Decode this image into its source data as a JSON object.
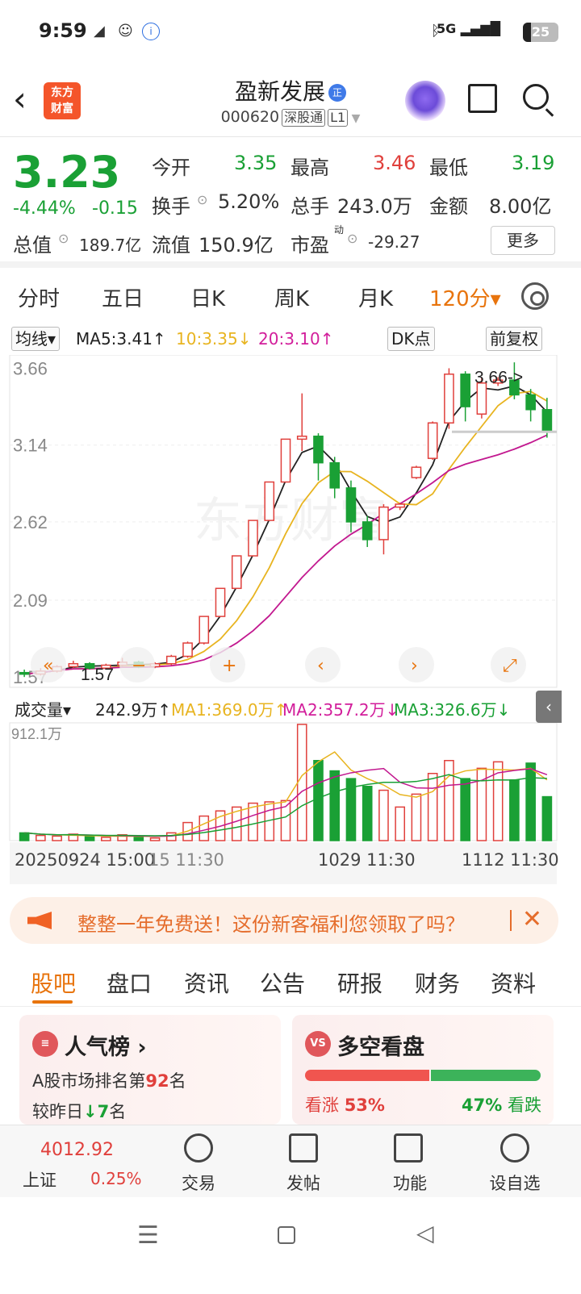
{
  "status": {
    "time": "9:59",
    "network": "5G",
    "battery": "25"
  },
  "header": {
    "back": "‹",
    "logo": "东方\n财富",
    "title": "盈新发展",
    "title_badge": "正",
    "code": "000620",
    "tag1": "深股通",
    "tag2": "L1"
  },
  "quote": {
    "price": "3.23",
    "pct": "-4.44%",
    "chg": "-0.15",
    "open_label": "今开",
    "open": "3.35",
    "high_label": "最高",
    "high": "3.46",
    "low_label": "最低",
    "low": "3.19",
    "turnover_label": "换手",
    "turnover": "5.20%",
    "vol_label": "总手",
    "vol": "243.0万",
    "amt_label": "金额",
    "amt": "8.00亿",
    "cap_label": "总值",
    "cap": "189.7亿",
    "float_label": "流值",
    "float": "150.9亿",
    "pe_label": "市盈",
    "pe_sup": "动",
    "pe": "-29.27",
    "more": "更多"
  },
  "tabs": [
    "分时",
    "五日",
    "日K",
    "周K",
    "月K",
    "120分▾"
  ],
  "ma": {
    "sel": "均线▾",
    "ma5": "MA5:3.41↑",
    "ma10": "10:3.35↓",
    "ma20": "20:3.10↑",
    "dk": "DK点",
    "fq": "前复权"
  },
  "chart_data": {
    "type": "candlestick",
    "yticks": [
      "3.66",
      "3.14",
      "2.62",
      "2.09",
      "1.57"
    ],
    "high_label": "3.66->",
    "low_label": "1.57",
    "vol_max": "912.1万",
    "volume_bar": {
      "sel": "成交量▾",
      "vol": "242.9万↑",
      "ma1": "MA1:369.0万↑",
      "ma2": "MA2:357.2万↓",
      "ma3": "MA3:326.6万↓"
    },
    "x_labels": [
      "20250924 15:00",
      "15 11:30",
      "1029 11:30",
      "1112 11:30"
    ],
    "watermark": "东方财富",
    "candles": [
      {
        "o": 1.6,
        "c": 1.59,
        "h": 1.62,
        "l": 1.57
      },
      {
        "o": 1.59,
        "c": 1.61,
        "h": 1.63,
        "l": 1.58
      },
      {
        "o": 1.61,
        "c": 1.64,
        "h": 1.65,
        "l": 1.6
      },
      {
        "o": 1.64,
        "c": 1.66,
        "h": 1.68,
        "l": 1.63
      },
      {
        "o": 1.66,
        "c": 1.63,
        "h": 1.67,
        "l": 1.62
      },
      {
        "o": 1.63,
        "c": 1.65,
        "h": 1.66,
        "l": 1.62
      },
      {
        "o": 1.65,
        "c": 1.67,
        "h": 1.7,
        "l": 1.64
      },
      {
        "o": 1.67,
        "c": 1.64,
        "h": 1.68,
        "l": 1.63
      },
      {
        "o": 1.64,
        "c": 1.66,
        "h": 1.67,
        "l": 1.63
      },
      {
        "o": 1.66,
        "c": 1.71,
        "h": 1.72,
        "l": 1.65
      },
      {
        "o": 1.71,
        "c": 1.8,
        "h": 1.81,
        "l": 1.7
      },
      {
        "o": 1.8,
        "c": 1.98,
        "h": 1.98,
        "l": 1.79
      },
      {
        "o": 1.98,
        "c": 2.17,
        "h": 2.17,
        "l": 1.98
      },
      {
        "o": 2.17,
        "c": 2.39,
        "h": 2.39,
        "l": 2.17
      },
      {
        "o": 2.39,
        "c": 2.63,
        "h": 2.63,
        "l": 2.39
      },
      {
        "o": 2.63,
        "c": 2.89,
        "h": 2.89,
        "l": 2.63
      },
      {
        "o": 2.89,
        "c": 3.18,
        "h": 3.18,
        "l": 3.18
      },
      {
        "o": 3.18,
        "c": 3.2,
        "h": 3.49,
        "l": 3.1
      },
      {
        "o": 3.2,
        "c": 3.02,
        "h": 3.22,
        "l": 2.9
      },
      {
        "o": 3.02,
        "c": 2.85,
        "h": 3.06,
        "l": 2.78
      },
      {
        "o": 2.85,
        "c": 2.62,
        "h": 2.9,
        "l": 2.55
      },
      {
        "o": 2.62,
        "c": 2.5,
        "h": 2.66,
        "l": 2.45
      },
      {
        "o": 2.5,
        "c": 2.72,
        "h": 2.74,
        "l": 2.4
      },
      {
        "o": 2.72,
        "c": 2.74,
        "h": 2.75,
        "l": 2.7
      },
      {
        "o": 2.92,
        "c": 2.99,
        "h": 3.0,
        "l": 2.91
      },
      {
        "o": 3.05,
        "c": 3.29,
        "h": 3.3,
        "l": 3.04
      },
      {
        "o": 3.29,
        "c": 3.62,
        "h": 3.66,
        "l": 3.25
      },
      {
        "o": 3.62,
        "c": 3.4,
        "h": 3.64,
        "l": 3.3
      },
      {
        "o": 3.35,
        "c": 3.56,
        "h": 3.6,
        "l": 3.32
      },
      {
        "o": 3.56,
        "c": 3.58,
        "h": 3.6,
        "l": 3.54
      },
      {
        "o": 3.58,
        "c": 3.48,
        "h": 3.7,
        "l": 3.45
      },
      {
        "o": 3.48,
        "c": 3.38,
        "h": 3.52,
        "l": 3.3
      },
      {
        "o": 3.38,
        "c": 3.23,
        "h": 3.46,
        "l": 3.19
      }
    ],
    "volumes": [
      60,
      40,
      35,
      50,
      30,
      25,
      45,
      30,
      20,
      60,
      140,
      190,
      230,
      260,
      290,
      300,
      310,
      900,
      620,
      540,
      480,
      420,
      390,
      260,
      360,
      520,
      620,
      480,
      560,
      610,
      470,
      600,
      340
    ]
  },
  "promo": {
    "text": "整整一年免费送！这份新客福利您领取了吗？",
    "close": "✕"
  },
  "tabs2": [
    "股吧",
    "盘口",
    "资讯",
    "公告",
    "研报",
    "财务",
    "资料"
  ],
  "card1": {
    "icon": "≡",
    "title": "人气榜 ›",
    "line1": "A股市场排名第",
    "rank": "92",
    "line1b": "名",
    "line2": "较昨日",
    "delta": "↓7",
    "line2b": "名"
  },
  "card2": {
    "icon": "VS",
    "title": "多空看盘",
    "up_label": "看涨",
    "up": "53%",
    "down": "47%",
    "down_label": "看跌"
  },
  "bottom": {
    "index_value": "4012.92",
    "index_name": "上证",
    "index_pct": "0.25%",
    "trade": "交易",
    "post": "发帖",
    "func": "功能",
    "watch": "设自选"
  }
}
